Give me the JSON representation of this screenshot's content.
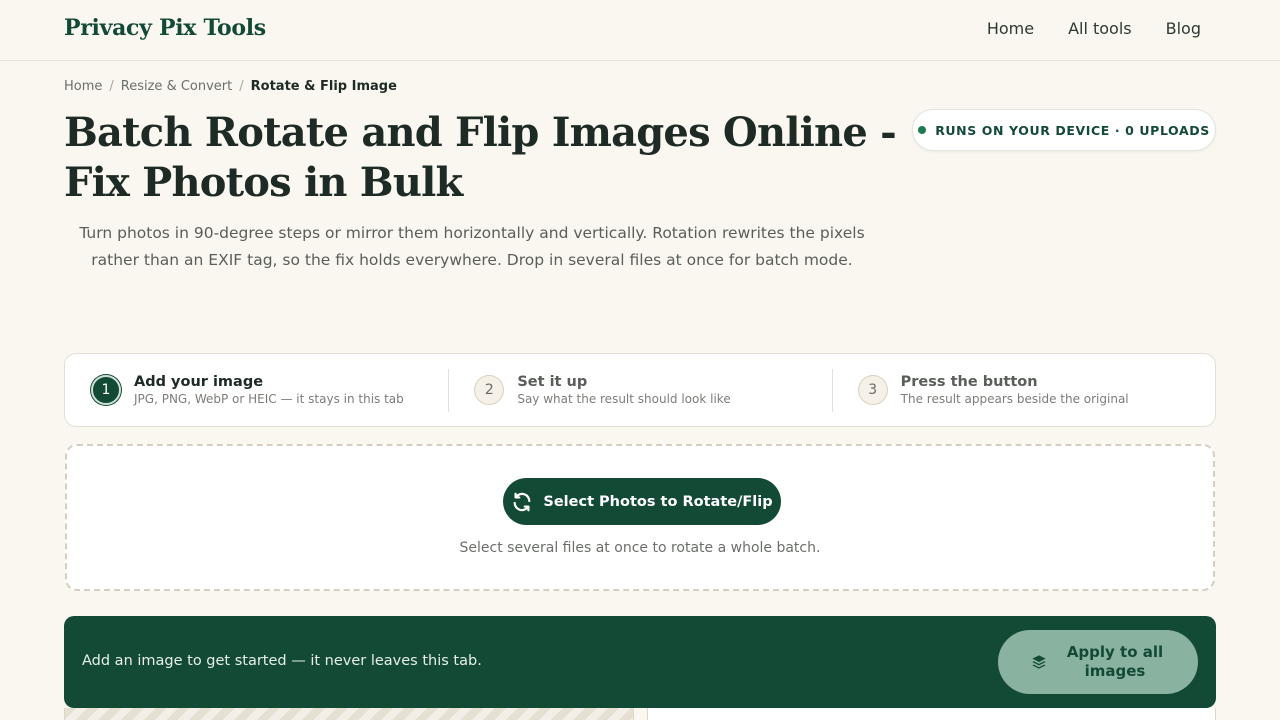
{
  "header": {
    "logo": "Privacy Pix Tools",
    "nav": [
      {
        "label": "Home"
      },
      {
        "label": "All tools"
      },
      {
        "label": "Blog"
      }
    ]
  },
  "breadcrumb": {
    "items": [
      "Home",
      "Resize & Convert"
    ],
    "current": "Rotate & Flip Image",
    "separator": "/"
  },
  "badge": {
    "label": "RUNS ON YOUR DEVICE · 0 UPLOADS",
    "dot_color": "#1f7a52"
  },
  "page": {
    "title": "Batch Rotate and Flip Images Online - Fix Photos in Bulk",
    "intro": "Turn photos in 90-degree steps or mirror them horizontally and vertically. Rotation rewrites the pixels rather than an EXIF tag, so the fix holds everywhere. Drop in several files at once for batch mode."
  },
  "steps": [
    {
      "num": "1",
      "title": "Add your image",
      "sub": "JPG, PNG, WebP or HEIC — it stays in this tab",
      "active": true
    },
    {
      "num": "2",
      "title": "Set it up",
      "sub": "Say what the result should look like",
      "active": false
    },
    {
      "num": "3",
      "title": "Press the button",
      "sub": "The result appears beside the original",
      "active": false
    }
  ],
  "dropzone": {
    "button_label": "Select Photos to Rotate/Flip",
    "button_icon": "rotate-icon",
    "hint": "Select several files at once to rotate a whole batch."
  },
  "action_bar": {
    "message": "Add an image to get started — it never leaves this tab.",
    "apply_label": "Apply to all images",
    "apply_icon": "layers-icon"
  },
  "colors": {
    "brand": "#134a36",
    "background": "#faf7f1",
    "apply_button": "#8ab2a0"
  }
}
